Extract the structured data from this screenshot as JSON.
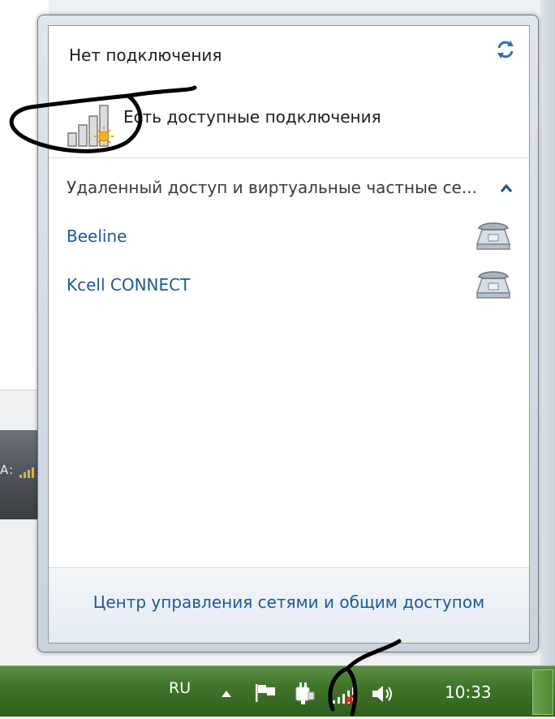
{
  "status": {
    "title": "Нет подключения",
    "available": "Есть доступные подключения"
  },
  "group": {
    "title": "Удаленный доступ и виртуальные частные се..."
  },
  "connections": [
    {
      "label": "Beeline"
    },
    {
      "label": "Kcell CONNECT"
    }
  ],
  "footer": {
    "link": "Центр управления сетями и общим доступом"
  },
  "taskbar": {
    "language": "RU",
    "time": "10:33"
  },
  "background": {
    "snippet": "A:"
  },
  "colors": {
    "link": "#1a5a9a",
    "taskbar": "#3f7529"
  },
  "icons": {
    "refresh": "refresh-icon",
    "signal": "signal-bars-icon",
    "collapse": "chevron-up-icon",
    "dialup": "telephone-icon",
    "flag": "action-center-flag-icon",
    "power": "power-plug-icon",
    "network": "network-signal-icon",
    "volume": "speaker-icon"
  }
}
